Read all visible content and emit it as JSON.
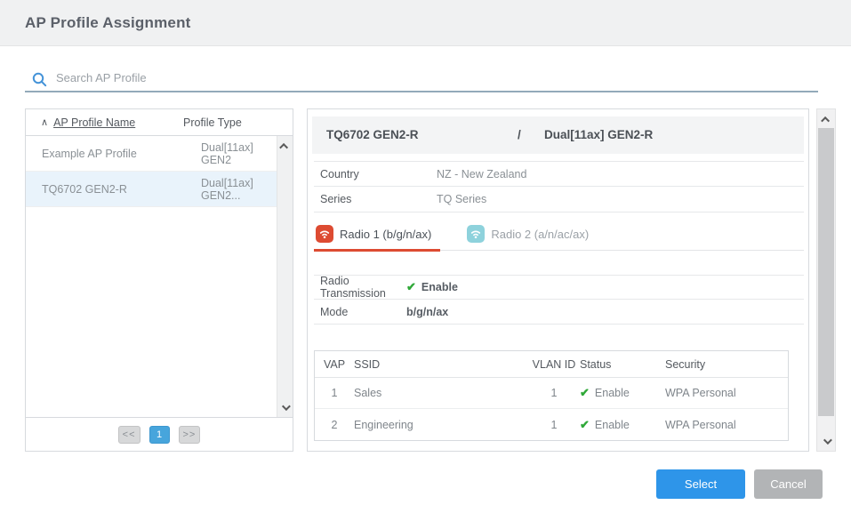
{
  "header": {
    "title": "AP Profile Assignment"
  },
  "search": {
    "placeholder": "Search AP Profile",
    "value": ""
  },
  "icons": {
    "sort_asc": "∧",
    "check": "✔",
    "search": "magnifier",
    "wifi": "wifi-waves"
  },
  "colors": {
    "accent_blue": "#2e95e9",
    "pagination_blue": "#47a5dc",
    "tab_active_red": "#dd4b32",
    "tab_inactive_teal": "#8ed2dc",
    "status_green": "#2fa838",
    "selected_row_bg": "#e9f3fb"
  },
  "profile_list": {
    "columns": {
      "name": "AP Profile Name",
      "type": "Profile Type"
    },
    "rows": [
      {
        "name": "Example AP Profile",
        "type": "Dual[11ax] GEN2"
      },
      {
        "name": "TQ6702 GEN2-R",
        "type": "Dual[11ax] GEN2..."
      }
    ],
    "pagination": {
      "prev": "<<",
      "page": "1",
      "next": ">>"
    }
  },
  "detail": {
    "profile_name": "TQ6702 GEN2-R",
    "separator": "/",
    "profile_type": "Dual[11ax] GEN2-R",
    "info_rows": [
      {
        "label": "Country",
        "value": "NZ - New Zealand"
      },
      {
        "label": "Series",
        "value": "TQ Series"
      }
    ],
    "tabs": [
      {
        "label": "Radio 1 (b/g/n/ax)"
      },
      {
        "label": "Radio 2 (a/n/ac/ax)"
      }
    ],
    "radio_rows": [
      {
        "label": "Radio Transmission",
        "value": "Enable"
      },
      {
        "label": "Mode",
        "value": "b/g/n/ax"
      }
    ],
    "vap_table": {
      "columns": [
        "VAP",
        "SSID",
        "VLAN ID",
        "Status",
        "Security"
      ],
      "rows": [
        {
          "vap": "1",
          "ssid": "Sales",
          "vlan": "1",
          "status": "Enable",
          "security": "WPA Personal"
        },
        {
          "vap": "2",
          "ssid": "Engineering",
          "vlan": "1",
          "status": "Enable",
          "security": "WPA Personal"
        }
      ]
    }
  },
  "footer": {
    "select_label": "Select",
    "cancel_label": "Cancel"
  }
}
